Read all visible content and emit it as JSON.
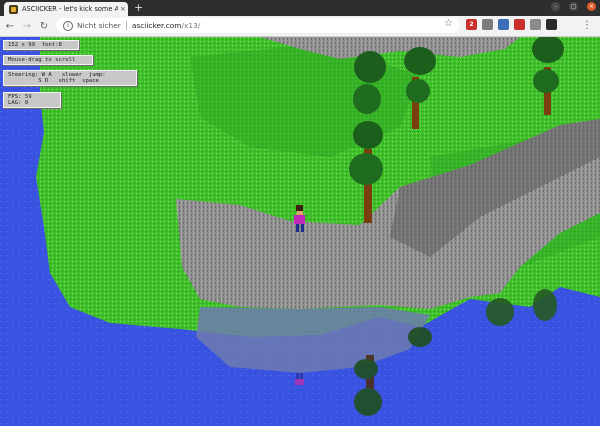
{
  "browser": {
    "tab_title": "ASCIICKER - let's kick some ASCII",
    "tab_close": "×",
    "new_tab": "+",
    "security_label": "Nicht sicher",
    "url_host": "asciicker.com",
    "url_path": "/x13/",
    "ext_icons": [
      {
        "name": "ext-abp-icon",
        "text": "2",
        "color": "#c9302c"
      },
      {
        "name": "ext-pocket-icon",
        "text": "",
        "color": "#7b7b7b"
      },
      {
        "name": "ext-hn-icon",
        "text": "",
        "color": "#3a6fb8"
      },
      {
        "name": "ext-adblock-icon",
        "text": "",
        "color": "#c9302c"
      },
      {
        "name": "ext-puzzle-icon",
        "text": "",
        "color": "#8a8a8a"
      },
      {
        "name": "ext-profile-icon",
        "text": "",
        "color": "#2a2a2a"
      }
    ]
  },
  "hud": {
    "size_line": "152 x 99  font:8",
    "mouse_hint": "Mouse-drag to scroll",
    "controls_line1": "Steering: W A   slower  jump:",
    "controls_line2": "         S D   shift  space",
    "fps_line1": "FPS: 59",
    "fps_line2": "LAG: 0"
  },
  "colors": {
    "water": "#3a52e0",
    "grass": "#3fbf2a",
    "grass_dark": "#1b8a1b",
    "rock": "#8c8c8c",
    "rock_dark": "#5f5f5f",
    "tree": "#1c5e1c",
    "trunk": "#7a3e10"
  }
}
